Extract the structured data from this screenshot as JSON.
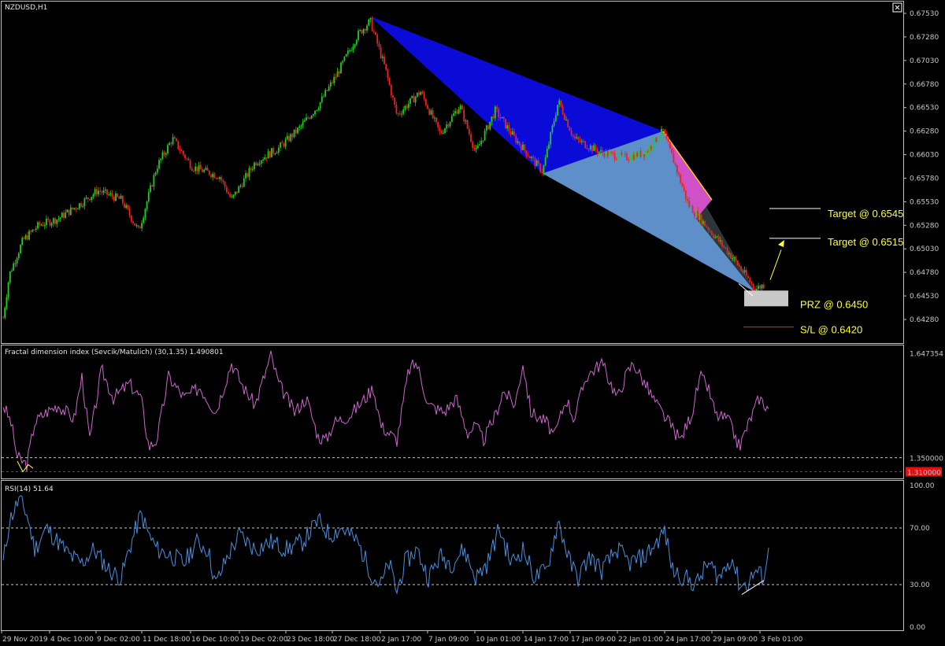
{
  "chart_data": [
    {
      "type": "candlestick",
      "title": "NZDUSD,H1",
      "yticks": [
        "0.67530",
        "0.67280",
        "0.67030",
        "0.66780",
        "0.66530",
        "0.66280",
        "0.66030",
        "0.65780",
        "0.65530",
        "0.65280",
        "0.65030",
        "0.64780",
        "0.64530",
        "0.64280"
      ],
      "ylim": [
        0.6405,
        0.677
      ],
      "colors": {
        "up": "#22cc22",
        "down": "#ee2222",
        "wick": "#aaaaaa"
      },
      "path": [
        [
          0,
          0.643
        ],
        [
          8,
          0.6476
        ],
        [
          25,
          0.6512
        ],
        [
          45,
          0.6528
        ],
        [
          70,
          0.6535
        ],
        [
          100,
          0.6552
        ],
        [
          120,
          0.6565
        ],
        [
          150,
          0.6555
        ],
        [
          172,
          0.6522
        ],
        [
          195,
          0.659
        ],
        [
          215,
          0.662
        ],
        [
          240,
          0.659
        ],
        [
          275,
          0.658
        ],
        [
          290,
          0.6555
        ],
        [
          320,
          0.6595
        ],
        [
          350,
          0.661
        ],
        [
          375,
          0.663
        ],
        [
          400,
          0.6655
        ],
        [
          425,
          0.669
        ],
        [
          450,
          0.673
        ],
        [
          466,
          0.6745
        ],
        [
          485,
          0.6695
        ],
        [
          500,
          0.6645
        ],
        [
          530,
          0.667
        ],
        [
          555,
          0.6625
        ],
        [
          580,
          0.6655
        ],
        [
          600,
          0.6605
        ],
        [
          625,
          0.665
        ],
        [
          650,
          0.662
        ],
        [
          685,
          0.6585
        ],
        [
          705,
          0.666
        ],
        [
          725,
          0.662
        ],
        [
          760,
          0.6605
        ],
        [
          790,
          0.66
        ],
        [
          815,
          0.6605
        ],
        [
          838,
          0.6628
        ],
        [
          850,
          0.66
        ],
        [
          870,
          0.655
        ],
        [
          900,
          0.652
        ],
        [
          930,
          0.649
        ],
        [
          955,
          0.646
        ],
        [
          968,
          0.6466
        ]
      ],
      "harmonic": {
        "X": [
          466,
          0.675
        ],
        "A": [
          685,
          0.6583
        ],
        "B": [
          838,
          0.6628
        ],
        "C": [
          880,
          0.6535
        ],
        "D": [
          955,
          0.6457
        ],
        "fill_XAB": "#0b0bd8",
        "fill_BD": "#5e8fc8",
        "fill_magenta": "#d050c8"
      },
      "annotations": [
        {
          "text": "Target @ 0.6545",
          "price": 0.6545
        },
        {
          "text": "Target @ 0.6515",
          "price": 0.6515
        },
        {
          "text": "PRZ @ 0.6450",
          "price": 0.645
        },
        {
          "text": "S/L @ 0.6420",
          "price": 0.642
        }
      ]
    },
    {
      "type": "line",
      "title": "Fractal dimension index (Sevcik/Matulich) (30,1.35) 1.490801",
      "yticks": [
        "1.647354",
        "1.350000",
        "1.310000"
      ],
      "ylim": [
        1.3,
        1.66
      ],
      "levels": [
        1.35,
        1.31
      ],
      "color": "#cc66cc",
      "x": [
        0,
        10,
        18,
        30,
        40,
        55,
        70,
        90,
        100,
        110,
        125,
        140,
        160,
        175,
        185,
        195,
        210,
        230,
        250,
        270,
        290,
        305,
        320,
        340,
        350,
        370,
        385,
        400,
        410,
        420,
        440,
        460,
        470,
        480,
        490,
        500,
        515,
        525,
        540,
        560,
        575,
        590,
        600,
        610,
        625,
        635,
        650,
        660,
        670,
        690,
        700,
        715,
        725,
        740,
        760,
        780,
        790,
        800,
        815,
        830,
        845,
        860,
        875,
        885,
        895,
        905,
        920,
        935,
        945,
        960,
        972
      ],
      "y": [
        1.5,
        1.45,
        1.35,
        1.33,
        1.45,
        1.48,
        1.5,
        1.46,
        1.58,
        1.4,
        1.6,
        1.52,
        1.56,
        1.52,
        1.38,
        1.4,
        1.58,
        1.52,
        1.55,
        1.48,
        1.62,
        1.55,
        1.5,
        1.64,
        1.56,
        1.48,
        1.52,
        1.41,
        1.4,
        1.45,
        1.47,
        1.52,
        1.55,
        1.44,
        1.42,
        1.4,
        1.6,
        1.62,
        1.5,
        1.48,
        1.52,
        1.42,
        1.44,
        1.4,
        1.47,
        1.54,
        1.5,
        1.62,
        1.48,
        1.45,
        1.41,
        1.52,
        1.46,
        1.58,
        1.62,
        1.52,
        1.58,
        1.62,
        1.56,
        1.5,
        1.45,
        1.4,
        1.48,
        1.58,
        1.55,
        1.47,
        1.46,
        1.38,
        1.44,
        1.52,
        1.49
      ]
    },
    {
      "type": "line",
      "title": "RSI(14) 51.64",
      "yticks": [
        "100.00",
        "70.00",
        "30.00",
        "0.00"
      ],
      "ylim": [
        0,
        100
      ],
      "levels": [
        70,
        30
      ],
      "color": "#4a8ede",
      "x": [
        0,
        8,
        20,
        30,
        40,
        55,
        70,
        85,
        100,
        115,
        135,
        150,
        160,
        175,
        185,
        195,
        215,
        230,
        245,
        260,
        270,
        285,
        300,
        320,
        340,
        360,
        380,
        400,
        415,
        430,
        450,
        470,
        480,
        490,
        500,
        510,
        525,
        540,
        555,
        570,
        585,
        600,
        615,
        630,
        645,
        660,
        675,
        690,
        705,
        720,
        730,
        745,
        760,
        780,
        795,
        815,
        830,
        840,
        850,
        865,
        880,
        895,
        910,
        925,
        935,
        945,
        955,
        965,
        972
      ],
      "y": [
        45,
        75,
        90,
        80,
        55,
        70,
        60,
        50,
        45,
        55,
        40,
        35,
        55,
        80,
        65,
        55,
        50,
        45,
        60,
        55,
        30,
        50,
        65,
        55,
        60,
        55,
        60,
        75,
        65,
        70,
        60,
        35,
        30,
        45,
        25,
        45,
        55,
        35,
        50,
        45,
        55,
        35,
        45,
        70,
        45,
        55,
        35,
        40,
        75,
        45,
        35,
        50,
        40,
        55,
        45,
        50,
        60,
        68,
        40,
        35,
        30,
        45,
        35,
        50,
        30,
        30,
        40,
        35,
        52
      ]
    }
  ],
  "xticks": [
    "29 Nov 2019",
    "4 Dec 10:00",
    "9 Dec 02:00",
    "11 Dec 18:00",
    "16 Dec 10:00",
    "19 Dec 02:00",
    "23 Dec 18:00",
    "27 Dec 18:00",
    "2 Jan 17:00",
    "7 Jan 09:00",
    "10 Jan 01:00",
    "14 Jan 17:00",
    "17 Jan 09:00",
    "22 Jan 01:00",
    "24 Jan 17:00",
    "29 Jan 09:00",
    "3 Feb 01:00"
  ],
  "fdi_level_value": "1.310000"
}
